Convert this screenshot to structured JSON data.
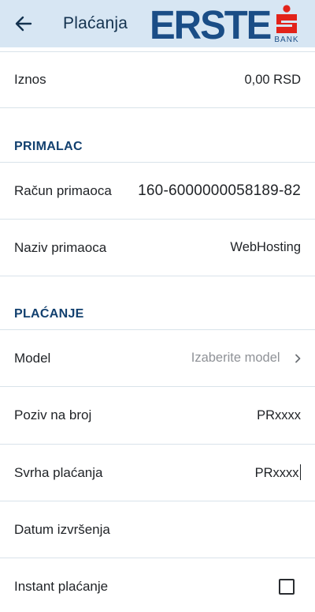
{
  "header": {
    "title": "Plaćanja",
    "back_icon": "arrow-left-icon",
    "logo_text": "ERSTE",
    "logo_bank": "BANK",
    "background": "#d7e6f3",
    "brand_color": "#1a4d86",
    "logo_mark_color": "#e2231a"
  },
  "amount": {
    "label": "Iznos",
    "value": "0,00 RSD"
  },
  "recipient_section": {
    "title": "PRIMALAC",
    "account": {
      "label": "Račun primaoca",
      "value": "160-6000000058189-82"
    },
    "name": {
      "label": "Naziv primaoca",
      "value": "WebHosting"
    }
  },
  "payment_section": {
    "title": "PLAĆANJE",
    "model": {
      "label": "Model",
      "placeholder": "Izaberite model",
      "icon": "chevron-right-icon"
    },
    "reference": {
      "label": "Poziv na broj",
      "value": "PRxxxx"
    },
    "purpose": {
      "label": "Svrha plaćanja",
      "value": "PRxxxx"
    },
    "execution_date": {
      "label": "Datum izvršenja",
      "value": ""
    },
    "instant": {
      "label": "Instant plaćanje",
      "checked": false
    }
  }
}
